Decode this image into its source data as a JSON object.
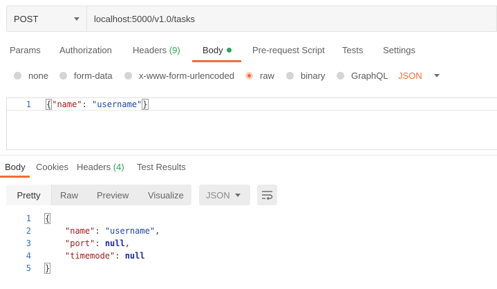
{
  "request": {
    "method": "POST",
    "url": "localhost:5000/v1.0/tasks"
  },
  "request_tabs": {
    "params": "Params",
    "authorization": "Authorization",
    "headers": "Headers",
    "headers_count": "(9)",
    "body": "Body",
    "pre_request_script": "Pre-request Script",
    "tests": "Tests",
    "settings": "Settings"
  },
  "body_types": {
    "none": "none",
    "form_data": "form-data",
    "urlencoded": "x-www-form-urlencoded",
    "raw": "raw",
    "binary": "binary",
    "graphql": "GraphQL",
    "selected": "raw",
    "language": "JSON"
  },
  "request_editor": {
    "line_number": "1",
    "open_brace": "{",
    "key": "\"name\"",
    "colon": ": ",
    "value": "\"username\"",
    "close_brace": "}"
  },
  "response_tabs": {
    "body": "Body",
    "cookies": "Cookies",
    "headers": "Headers",
    "headers_count": "(4)",
    "test_results": "Test Results"
  },
  "response_toolbar": {
    "pretty": "Pretty",
    "raw": "Raw",
    "preview": "Preview",
    "visualize": "Visualize",
    "format": "JSON"
  },
  "response_body": {
    "line_numbers": [
      "1",
      "2",
      "3",
      "4",
      "5"
    ],
    "open_brace": "{",
    "close_brace": "}",
    "name_key": "\"name\"",
    "name_value": "\"username\"",
    "port_key": "\"port\"",
    "port_value": "null",
    "timemode_key": "\"timemode\"",
    "timemode_value": "null",
    "colon": ": ",
    "comma": ","
  },
  "colors": {
    "accent": "#f26b3a",
    "count_green": "#26a85b",
    "line_number_blue": "#2f6fbf"
  },
  "icons": {
    "method_dropdown": "chevron-down-icon",
    "language_dropdown": "chevron-down-icon",
    "format_dropdown": "chevron-down-icon",
    "wrap": "wrap-lines-icon"
  }
}
